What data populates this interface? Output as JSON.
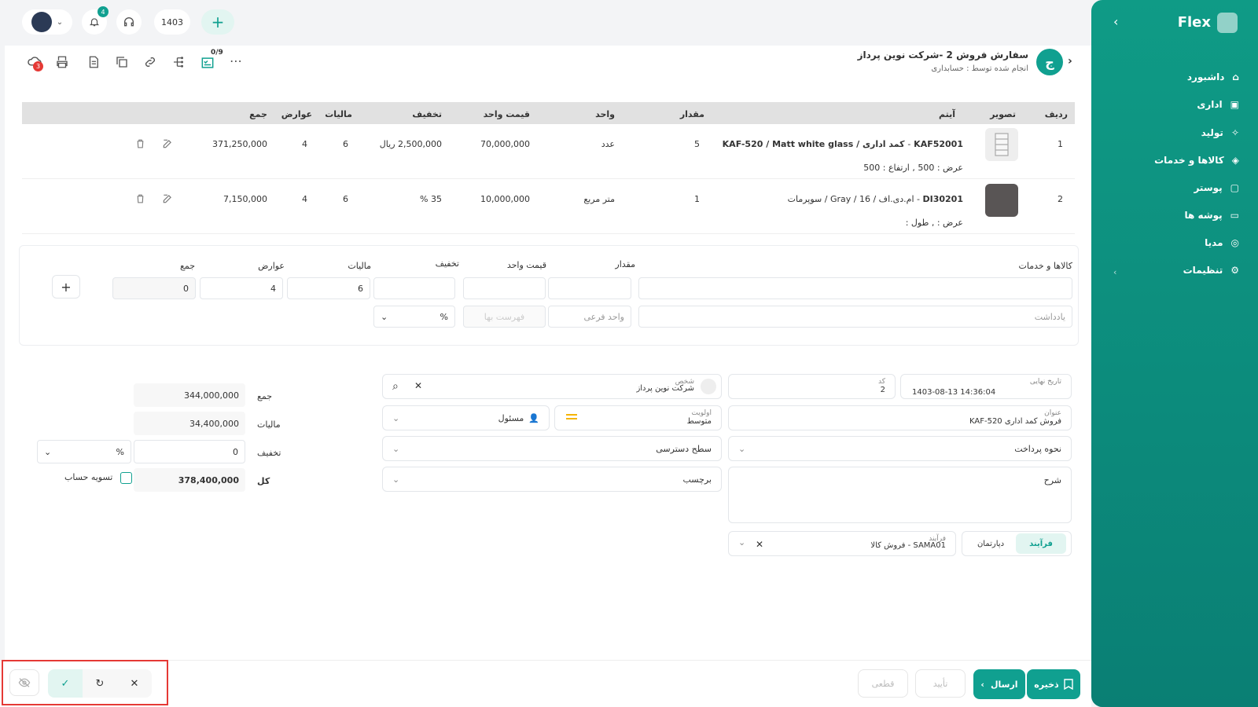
{
  "topbar": {
    "notif_count": "4",
    "year": "1403"
  },
  "header": {
    "avatar_letter": "ج",
    "title": "سفارش فروش 2 -شرکت نوین پرداز",
    "subtitle": "انجام شده توسط : حسابداری",
    "checklist_count": "0/9",
    "cloud_badge": "3"
  },
  "sidebar": {
    "brand": "Flex",
    "items": [
      {
        "label": "داشبورد",
        "icon": "home-icon"
      },
      {
        "label": "اداری",
        "icon": "briefcase-icon"
      },
      {
        "label": "تولید",
        "icon": "factory-icon"
      },
      {
        "label": "کالاها و خدمات",
        "icon": "box-icon"
      },
      {
        "label": "پوستر",
        "icon": "image-icon"
      },
      {
        "label": "پوشه ها",
        "icon": "folder-icon"
      },
      {
        "label": "مدیا",
        "icon": "media-icon"
      },
      {
        "label": "تنظیمات",
        "icon": "gear-icon"
      }
    ]
  },
  "table": {
    "headers": [
      "ردیف",
      "تصویر",
      "آیتم",
      "مقدار",
      "واحد",
      "قیمت واحد",
      "تخفیف",
      "مالیات",
      "عوارض",
      "جمع"
    ],
    "rows": [
      {
        "idx": "1",
        "code": "KAF52001",
        "name": "کمد اداری / KAF-520 / Matt white glass",
        "sep": "-",
        "sub": "عرض : 500 ,  ارتفاع : 500",
        "qty": "5",
        "unit": "عدد",
        "price": "70,000,000",
        "discount": "2,500,000 ریال",
        "tax": "6",
        "duty": "4",
        "total": "371,250,000"
      },
      {
        "idx": "2",
        "code": "DI30201",
        "name": "ام.دی.اف / 16 / Gray / سوپرمات",
        "sep": "-",
        "sub": "عرض : ,  طول :",
        "qty": "1",
        "unit": "متر مربع",
        "price": "10,000,000",
        "discount": "35 %",
        "tax": "6",
        "duty": "4",
        "total": "7,150,000"
      }
    ]
  },
  "entry": {
    "labels": {
      "goods": "کالاها و خدمات",
      "qty": "مقدار",
      "price": "قیمت واحد",
      "discount": "تخفیف",
      "tax": "مالیات",
      "duty": "عوارض",
      "total": "جمع"
    },
    "tax_value": "6",
    "duty_value": "4",
    "total_value": "0",
    "note_placeholder": "یادداشت",
    "subunit_placeholder": "واحد فرعی",
    "pricelist_placeholder": "فهرست بها",
    "percent": "%"
  },
  "form": {
    "final_date_label": "تاریخ نهایی",
    "final_date_value": "1403-08-13 14:36:04",
    "code_label": "کد",
    "code_value": "2",
    "person_label": "شخص",
    "person_value": "شرکت نوین پرداز",
    "title_label": "عنوان",
    "title_value": "فروش کمد اداری  KAF-520",
    "priority_label": "اولویت",
    "priority_value": "متوسط",
    "responsible": "مسئول",
    "payment": "نحوه پرداخت",
    "access": "سطح دسترسی",
    "tag": "برچسب",
    "description": "شرح",
    "tab_process": "فرآیند",
    "tab_department": "دپارتمان",
    "process_label": "فرآیند",
    "process_value": "SAMA01 - فروش کالا"
  },
  "summary": {
    "sum_label": "جمع",
    "sum_value": "344,000,000",
    "tax_label": "مالیات",
    "tax_value": "34,400,000",
    "discount_label": "تخفیف",
    "discount_value": "0",
    "percent": "%",
    "total_label": "کل",
    "total_value": "378,400,000",
    "settle_label": "تسویه حساب"
  },
  "footer": {
    "save": "ذخیره",
    "send": "ارسال",
    "confirm": "تأیید",
    "final": "قطعی"
  },
  "colors": {
    "accent": "#10a090",
    "highlight_box": "#e53935"
  }
}
